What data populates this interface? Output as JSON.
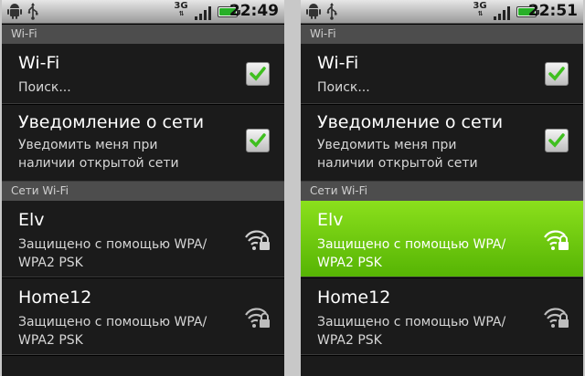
{
  "screens": [
    {
      "status": {
        "network": "3G",
        "time": "22:49"
      },
      "section_wifi": "Wi-Fi",
      "wifi_row": {
        "title": "Wi-Fi",
        "subtitle": "Поиск...",
        "checked": true
      },
      "notify_row": {
        "title": "Уведомление о сети",
        "subtitle_line1": "Уведомить меня при",
        "subtitle_line2": "наличии открытой сети",
        "checked": true
      },
      "section_networks": "Сети Wi-Fi",
      "networks": [
        {
          "name": "Elv",
          "line1": "Защищено с помощью WPA/",
          "line2": "WPA2 PSK",
          "selected": false
        },
        {
          "name": "Home12",
          "line1": "Защищено с помощью WPA/",
          "line2": "WPA2 PSK",
          "selected": false
        }
      ]
    },
    {
      "status": {
        "network": "3G",
        "time": "22:51"
      },
      "section_wifi": "Wi-Fi",
      "wifi_row": {
        "title": "Wi-Fi",
        "subtitle": "Поиск...",
        "checked": true
      },
      "notify_row": {
        "title": "Уведомление о сети",
        "subtitle_line1": "Уведомить меня при",
        "subtitle_line2": "наличии открытой сети",
        "checked": true
      },
      "section_networks": "Сети Wi-Fi",
      "networks": [
        {
          "name": "Elv",
          "line1": "Защищено с помощью WPA/",
          "line2": "WPA2 PSK",
          "selected": true
        },
        {
          "name": "Home12",
          "line1": "Защищено с помощью WPA/",
          "line2": "WPA2 PSK",
          "selected": false
        }
      ]
    }
  ],
  "colors": {
    "selected_top": "#8be01c",
    "selected_bottom": "#56b404",
    "background": "#1b1b1b",
    "section": "#4d4d4d"
  },
  "icons": [
    "android-icon",
    "usb-icon",
    "signal-icon",
    "battery-icon",
    "checkmark-icon",
    "wifi-lock-icon"
  ]
}
